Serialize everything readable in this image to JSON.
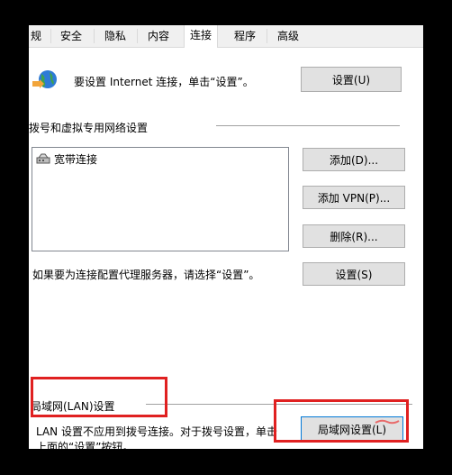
{
  "tabs": [
    {
      "label": "规",
      "active": false
    },
    {
      "label": "安全",
      "active": false
    },
    {
      "label": "隐私",
      "active": false
    },
    {
      "label": "内容",
      "active": false
    },
    {
      "label": "连接",
      "active": true
    },
    {
      "label": "程序",
      "active": false
    },
    {
      "label": "高级",
      "active": false
    }
  ],
  "setup": {
    "text": "要设置 Internet 连接，单击“设置”。",
    "button": "设置(U)"
  },
  "dialup": {
    "heading": "拨号和虚拟专用网络设置",
    "connections": [
      "宽带连接"
    ],
    "add_button": "添加(D)...",
    "add_vpn_button": "添加 VPN(P)...",
    "remove_button": "删除(R)..."
  },
  "proxy": {
    "text": "如果要为连接配置代理服务器，请选择“设置”。",
    "button": "设置(S)"
  },
  "lan": {
    "heading": "局域网(LAN)设置",
    "desc_line1": "LAN 设置不应用到拨号连接。对于拨号设置，单击",
    "desc_line2": "上面的“设置”按钮。",
    "button": "局域网设置(L)"
  },
  "colors": {
    "highlight_box": "#e02020",
    "dialog_bg": "#ffffff",
    "frame_bg": "#000000",
    "button_bg": "#e1e1e1"
  }
}
